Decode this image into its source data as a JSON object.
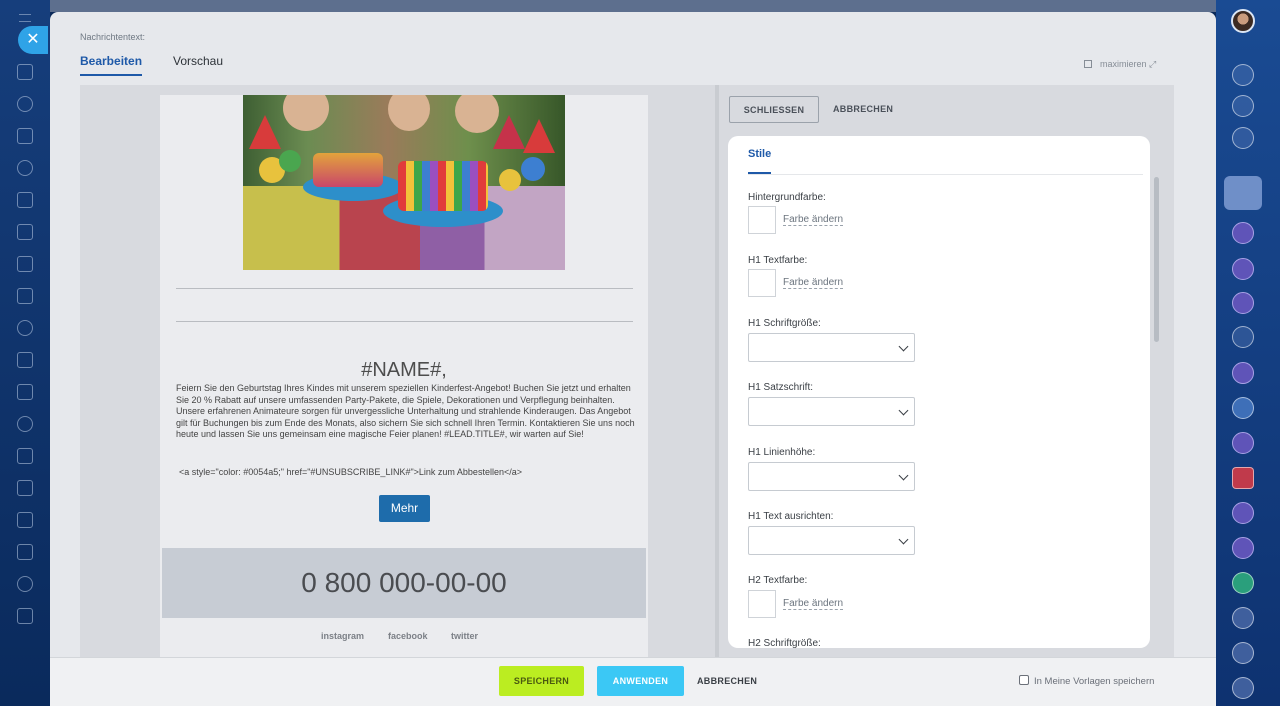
{
  "panel": {
    "label": "Nachrichtentext:",
    "tabs": [
      "Bearbeiten",
      "Vorschau"
    ],
    "maximize": "maximieren"
  },
  "email": {
    "greeting": "#NAME#,",
    "body": "Feiern Sie den Geburtstag Ihres Kindes mit unserem speziellen Kinderfest-Angebot! Buchen Sie jetzt und erhalten Sie 20 % Rabatt auf unsere umfassenden Party-Pakete, die Spiele, Dekorationen und Verpflegung beinhalten. Unsere erfahrenen Animateure sorgen für unvergessliche Unterhaltung und strahlende Kinderaugen. Das Angebot gilt für Buchungen bis zum Ende des Monats, also sichern Sie sich schnell Ihren Termin. Kontaktieren Sie uns noch heute und lassen Sie uns gemeinsam eine magische Feier planen! #LEAD.TITLE#, wir warten auf Sie!",
    "unsubscribe": "<a style=\"color: #0054a5;\" href=\"#UNSUBSCRIBE_LINK#\">Link zum Abbestellen</a>",
    "button": "Mehr",
    "phone": "0 800 000-00-00",
    "social": [
      "instagram",
      "facebook",
      "twitter"
    ]
  },
  "editor": {
    "close": "SCHLIESSEN",
    "cancel": "ABBRECHEN",
    "tab": "Stile",
    "change": "Farbe ändern",
    "fields": {
      "bg": "Hintergrundfarbe:",
      "h1color": "H1 Textfarbe:",
      "h1size": "H1 Schriftgröße:",
      "h1font": "H1 Satzschrift:",
      "h1line": "H1 Linienhöhe:",
      "h1align": "H1 Text ausrichten:",
      "h2color": "H2 Textfarbe:",
      "h2size": "H2 Schriftgröße:"
    }
  },
  "footer": {
    "save": "SPEICHERN",
    "apply": "ANWENDEN",
    "cancel": "ABBRECHEN",
    "template": "In Meine Vorlagen speichern"
  },
  "colors": {
    "accent": "#1e59a8",
    "save": "#bbed21",
    "apply": "#3bc8f5",
    "mehr": "#1e6cab"
  }
}
